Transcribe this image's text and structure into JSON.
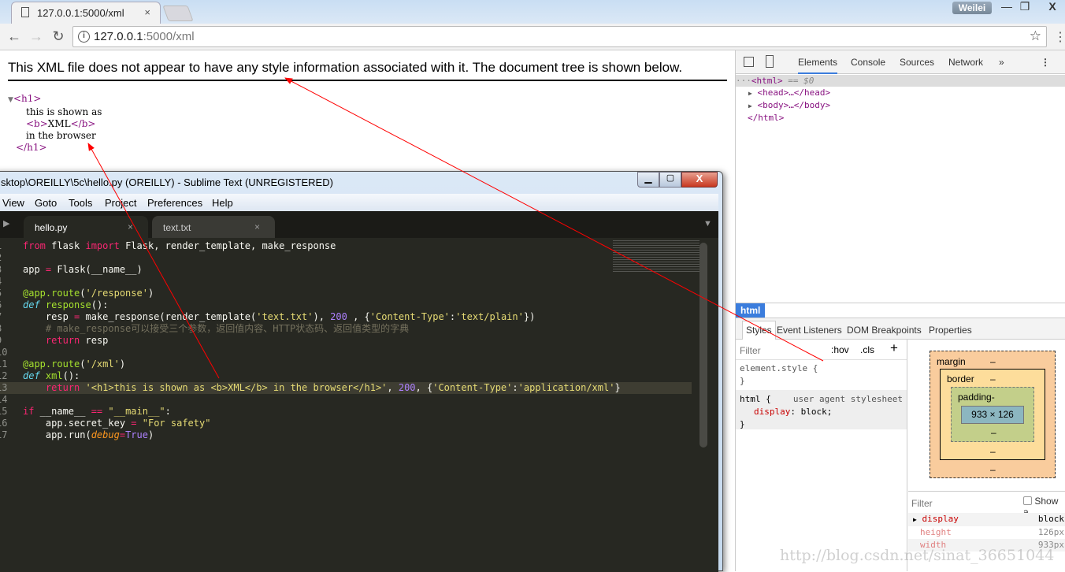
{
  "browser": {
    "tab_title": "127.0.0.1:5000/xml",
    "tab_close": "×",
    "user": "Weilei",
    "url_host": "127.0.0.1",
    "url_rest": ":5000/xml",
    "min": "—",
    "restore": "❐",
    "close": "X",
    "back": "←",
    "forward": "→",
    "reload": "↻",
    "star": "☆",
    "menu": "⋮",
    "info": "i"
  },
  "page": {
    "message": "This XML file does not appear to have any style information associated with it. The document tree is shown below.",
    "tree": {
      "toggle": "▼",
      "open": "<h1>",
      "text1": "this is shown as",
      "b_open": "<b>",
      "b_text": "XML",
      "b_close": "</b>",
      "text2": "in the browser",
      "close": "</h1>"
    }
  },
  "devtools": {
    "tabs": [
      "Elements",
      "Console",
      "Sources",
      "Network",
      "»"
    ],
    "dom": {
      "sel_prefix": "···",
      "sel_tag": "<html>",
      "sel_suffix": " == $0",
      "head": "<head>…</head>",
      "body": "<body>…</body>",
      "html_close": "</html>",
      "arrow": "▶"
    },
    "crumb": "html",
    "subtabs": [
      "Styles",
      "Event Listeners",
      "DOM Breakpoints",
      "Properties"
    ],
    "filter": "Filter",
    "hov": ":hov",
    "cls": ".cls",
    "plus": "+",
    "element_style": "element.style {",
    "brace_close": "}",
    "rule_selector": "html {",
    "rule_source": "user agent stylesheet",
    "rule_prop": "display",
    "rule_val": "block;",
    "box": {
      "margin": "margin",
      "border": "border",
      "padding": "padding-",
      "content": "933 × 126",
      "dash": "–"
    },
    "computed": {
      "filter": "Filter",
      "show_all": "Show a",
      "rows": [
        {
          "prop": "display",
          "val": "block"
        },
        {
          "prop": "height",
          "val": "126px"
        },
        {
          "prop": "width",
          "val": "933px"
        }
      ]
    }
  },
  "sublime": {
    "title": "sktop\\OREILLY\\5c\\hello.py (OREILLY) - Sublime Text (UNREGISTERED)",
    "menu": [
      "View",
      "Goto",
      "Tools",
      "Project",
      "Preferences",
      "Help"
    ],
    "tabs": [
      {
        "label": "hello.py",
        "close": "×"
      },
      {
        "label": "text.txt",
        "close": "×"
      }
    ],
    "lines": [
      [
        [
          "from",
          "k"
        ],
        [
          " flask ",
          "w"
        ],
        [
          "import",
          "k"
        ],
        [
          " Flask, render_template, make_response",
          "w"
        ]
      ],
      [],
      [
        [
          "app ",
          "w"
        ],
        [
          "=",
          "k"
        ],
        [
          " Flask(__name__)",
          "w"
        ]
      ],
      [],
      [
        [
          "@app.route",
          "g"
        ],
        [
          "(",
          "w"
        ],
        [
          "'/response'",
          "y"
        ],
        [
          ")",
          "w"
        ]
      ],
      [
        [
          "def",
          "c"
        ],
        [
          " ",
          "w"
        ],
        [
          "response",
          "g"
        ],
        [
          "():",
          "w"
        ]
      ],
      [
        [
          "    resp ",
          "w"
        ],
        [
          "=",
          "k"
        ],
        [
          " make_response(render_template(",
          "w"
        ],
        [
          "'text.txt'",
          "y"
        ],
        [
          "), ",
          "w"
        ],
        [
          "200",
          "p"
        ],
        [
          " , {",
          "w"
        ],
        [
          "'Content-Type'",
          "y"
        ],
        [
          ":",
          "w"
        ],
        [
          "'text/plain'",
          "y"
        ],
        [
          "})",
          "w"
        ]
      ],
      [
        [
          "    # make_response可以接受三个参数，返回值内容、HTTP状态码、返回值类型的字典",
          "cm"
        ]
      ],
      [
        [
          "    ",
          "w"
        ],
        [
          "return",
          "k"
        ],
        [
          " resp",
          "w"
        ]
      ],
      [],
      [
        [
          "@app.route",
          "g"
        ],
        [
          "(",
          "w"
        ],
        [
          "'/xml'",
          "y"
        ],
        [
          ")",
          "w"
        ]
      ],
      [
        [
          "def",
          "c"
        ],
        [
          " ",
          "w"
        ],
        [
          "xml",
          "g"
        ],
        [
          "():",
          "w"
        ]
      ],
      [
        [
          "    ",
          "w"
        ],
        [
          "return",
          "k"
        ],
        [
          " ",
          "w"
        ],
        [
          "'<h1>this is shown as <b>XML</b> in the browser</h1>'",
          "y"
        ],
        [
          ", ",
          "w"
        ],
        [
          "200",
          "p"
        ],
        [
          ", {",
          "w"
        ],
        [
          "'Content-Type'",
          "y"
        ],
        [
          ":",
          "w"
        ],
        [
          "'application/xml'",
          "y"
        ],
        [
          "}",
          "w"
        ]
      ],
      [],
      [
        [
          "if",
          "k"
        ],
        [
          " __name__ ",
          "w"
        ],
        [
          "==",
          "k"
        ],
        [
          " ",
          "w"
        ],
        [
          "\"__main__\"",
          "y"
        ],
        [
          ":",
          "w"
        ]
      ],
      [
        [
          "    app.secret_key ",
          "w"
        ],
        [
          "=",
          "k"
        ],
        [
          " ",
          "w"
        ],
        [
          "\"For safety\"",
          "y"
        ]
      ],
      [
        [
          "    app.run(",
          "w"
        ],
        [
          "debug",
          "o"
        ],
        [
          "=",
          "k"
        ],
        [
          "True",
          "p"
        ],
        [
          ")",
          "w"
        ]
      ]
    ]
  },
  "watermark": "http://blog.csdn.net/sinat_36651044",
  "colors": {
    "accent": "#3b7ddd",
    "annotation": "#ff0000",
    "editor_bg": "#272822"
  }
}
